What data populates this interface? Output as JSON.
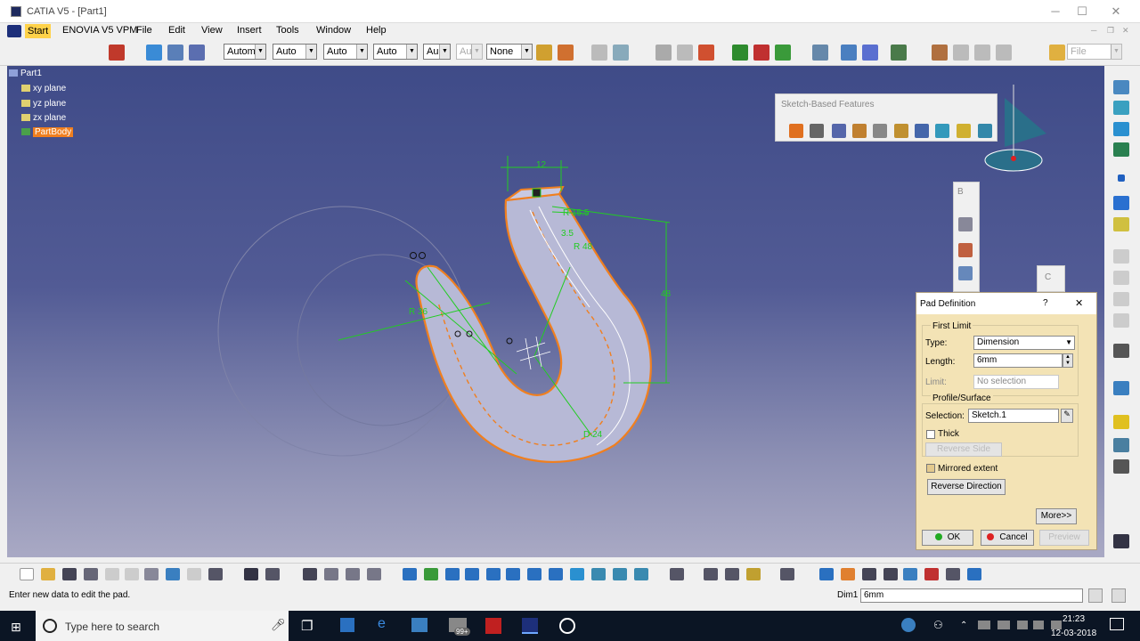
{
  "window": {
    "title": "CATIA V5 - [Part1]",
    "minimize": "─",
    "maximize": "☐",
    "close": "✕"
  },
  "menu": {
    "items": [
      "Start",
      "ENOVIA V5 VPM",
      "File",
      "Edit",
      "View",
      "Insert",
      "Tools",
      "Window",
      "Help"
    ]
  },
  "toolbar": {
    "combos": [
      "Autom",
      "Auto",
      "Auto",
      "Auto",
      "Au",
      "Au",
      "None"
    ],
    "file_combo": "File"
  },
  "tree": {
    "root": "Part1",
    "items": [
      "xy plane",
      "yz plane",
      "zx plane",
      "PartBody"
    ]
  },
  "sketch_toolbar": {
    "title": "Sketch-Based Features"
  },
  "small_toolbar1": {
    "title": "B"
  },
  "small_toolbar2": {
    "title": "C"
  },
  "dimensions": {
    "d1": "12",
    "d2": "R 15.5",
    "d3": "3.5",
    "d4": "R 48",
    "d5": "48",
    "d6": "R 36",
    "d7": "D 24"
  },
  "pad_dialog": {
    "title": "Pad Definition",
    "help": "?",
    "close": "✕",
    "first_limit_label": "First Limit",
    "type_label": "Type:",
    "type_value": "Dimension",
    "length_label": "Length:",
    "length_value": "6mm",
    "limit_label": "Limit:",
    "limit_value": "No selection",
    "profile_label": "Profile/Surface",
    "selection_label": "Selection:",
    "selection_value": "Sketch.1",
    "thick_label": "Thick",
    "reverse_side_label": "Reverse Side",
    "mirrored_label": "Mirrored extent",
    "reverse_dir_label": "Reverse Direction",
    "more_label": "More>>",
    "ok_label": "OK",
    "cancel_label": "Cancel",
    "preview_label": "Preview"
  },
  "status": {
    "message": "Enter new data to edit the pad.",
    "dim_label": "Dim1",
    "dim_value": "6mm"
  },
  "taskbar": {
    "search_placeholder": "Type here to search",
    "badge": "99+",
    "time": "21:23",
    "date": "12-03-2018"
  },
  "colors": {
    "viewport_top": "#3f4b88",
    "selection": "#f07f1f",
    "dialog_bg": "#f3e3b5",
    "sketch_green": "#22cc22"
  }
}
